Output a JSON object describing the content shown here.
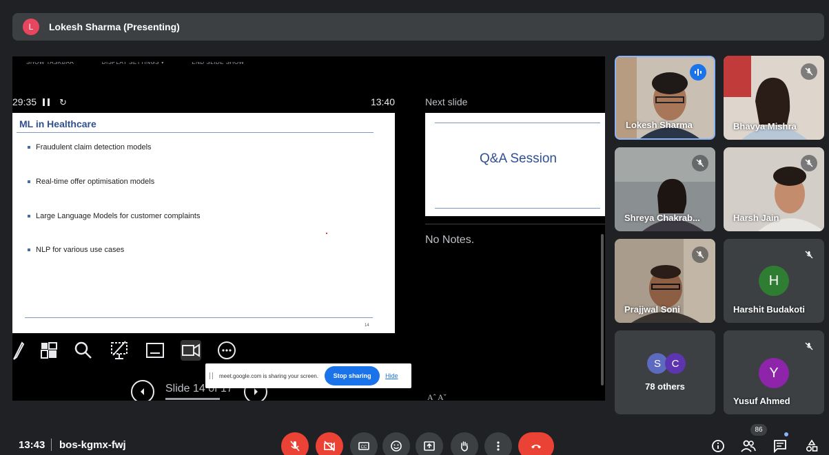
{
  "presenter": {
    "initial": "L",
    "label": "Lokesh Sharma (Presenting)"
  },
  "powerpoint": {
    "toolbar": [
      "SHOW TASKBAR",
      "DISPLAY SETTINGS ▾",
      "END SLIDE SHOW"
    ],
    "elapsed": "29:35",
    "clock": "13:40",
    "slide": {
      "title": "ML in Healthcare",
      "bullets": [
        "Fraudulent claim detection models",
        "Real-time offer optimisation models",
        "Large Language Models for customer complaints",
        "NLP for various use cases"
      ],
      "number": "14"
    },
    "navigation": {
      "label": "Slide 14 of 17",
      "progress": 0.82
    },
    "next_slide_label": "Next slide",
    "next_slide_title": "Q&A Session",
    "notes": "No Notes.",
    "font_adjust": "Aˆ  Aˇ"
  },
  "share_banner": {
    "text": "meet.google.com is sharing your screen.",
    "stop_label": "Stop sharing",
    "hide_label": "Hide"
  },
  "participants": [
    {
      "name": "Lokesh Sharma"
    },
    {
      "name": "Bhavya Mishra"
    },
    {
      "name": "Shreya Chakrab..."
    },
    {
      "name": "Harsh Jain"
    },
    {
      "name": "Prajjwal Soni"
    },
    {
      "name": "Harshit Budakoti",
      "initial": "H",
      "color": "#2e7d32"
    },
    {
      "label": "78 others",
      "initials": [
        "S",
        "C"
      ],
      "colors": [
        "#5c6bc0",
        "#5e35b1"
      ]
    },
    {
      "name": "Yusuf Ahmed",
      "initial": "Y",
      "color": "#8e24aa"
    }
  ],
  "bottom_bar": {
    "time": "13:43",
    "code": "bos-kgmx-fwj",
    "participant_count": "86"
  },
  "colors": {
    "accent": "#1a73e8",
    "danger": "#ea4335",
    "tile": "#3c4043"
  }
}
